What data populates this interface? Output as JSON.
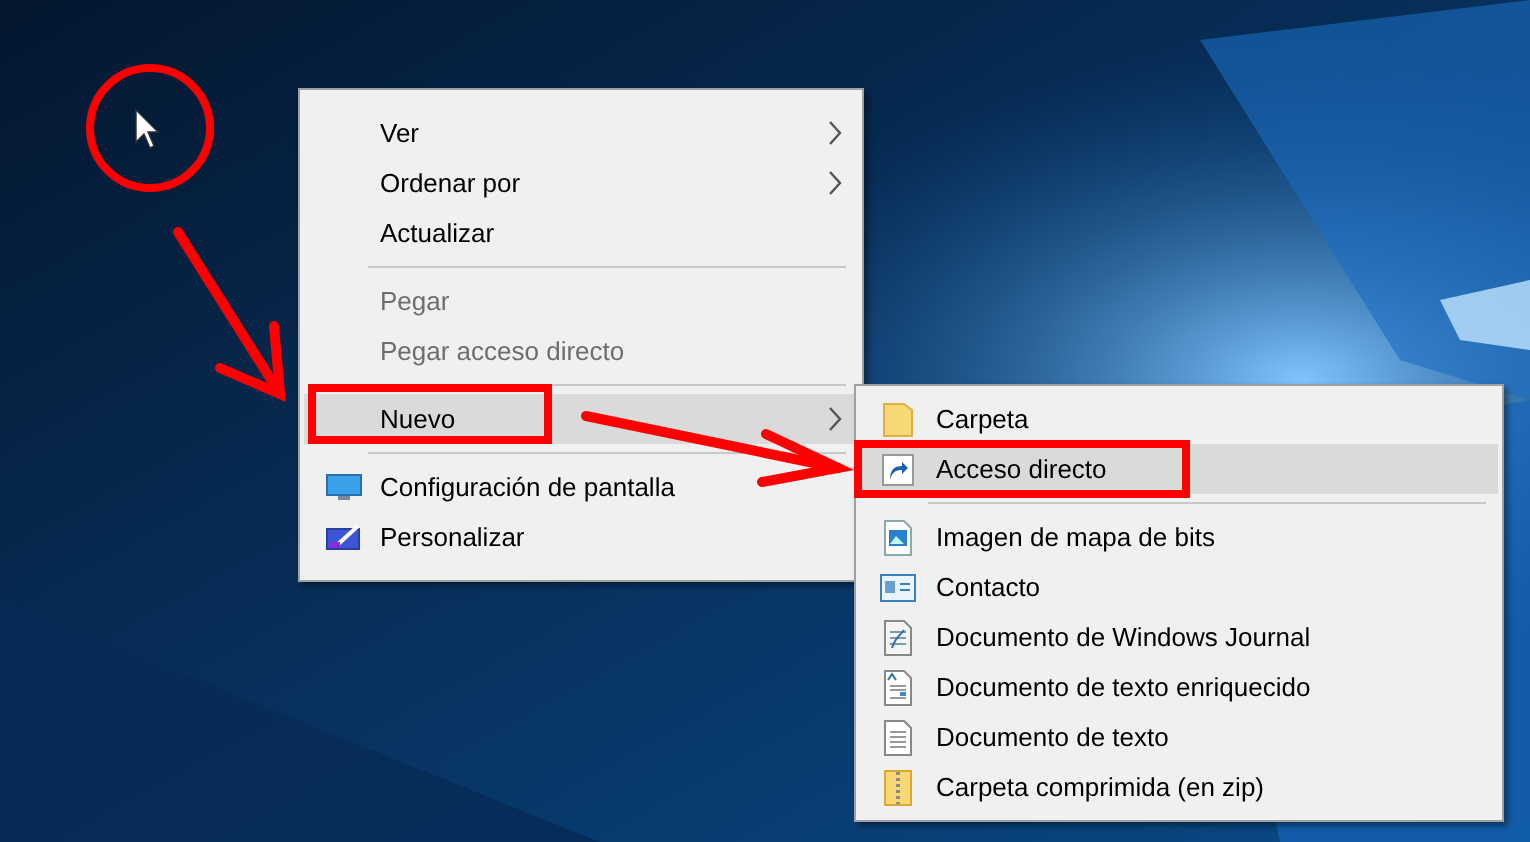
{
  "context_menu": {
    "items": [
      {
        "kind": "item",
        "label": "Ver",
        "submenu": true,
        "disabled": false,
        "selected": false
      },
      {
        "kind": "item",
        "label": "Ordenar por",
        "submenu": true,
        "disabled": false,
        "selected": false
      },
      {
        "kind": "item",
        "label": "Actualizar",
        "submenu": false,
        "disabled": false,
        "selected": false
      },
      {
        "kind": "separator"
      },
      {
        "kind": "item",
        "label": "Pegar",
        "submenu": false,
        "disabled": true,
        "selected": false
      },
      {
        "kind": "item",
        "label": "Pegar acceso directo",
        "submenu": false,
        "disabled": true,
        "selected": false
      },
      {
        "kind": "separator"
      },
      {
        "kind": "item",
        "label": "Nuevo",
        "submenu": true,
        "disabled": false,
        "selected": true
      },
      {
        "kind": "separator"
      },
      {
        "kind": "item",
        "label": "Configuración de pantalla",
        "submenu": false,
        "disabled": false,
        "selected": false
      },
      {
        "kind": "item",
        "label": "Personalizar",
        "submenu": false,
        "disabled": false,
        "selected": false
      }
    ]
  },
  "new_submenu": {
    "items": [
      {
        "kind": "item",
        "label": "Carpeta",
        "selected": false
      },
      {
        "kind": "item",
        "label": "Acceso directo",
        "selected": true
      },
      {
        "kind": "separator"
      },
      {
        "kind": "item",
        "label": "Imagen de mapa de bits",
        "selected": false
      },
      {
        "kind": "item",
        "label": "Contacto",
        "selected": false
      },
      {
        "kind": "item",
        "label": "Documento de Windows Journal",
        "selected": false
      },
      {
        "kind": "item",
        "label": "Documento de texto enriquecido",
        "selected": false
      },
      {
        "kind": "item",
        "label": "Documento de texto",
        "selected": false
      },
      {
        "kind": "item",
        "label": "Carpeta comprimida (en zip)",
        "selected": false
      }
    ]
  }
}
